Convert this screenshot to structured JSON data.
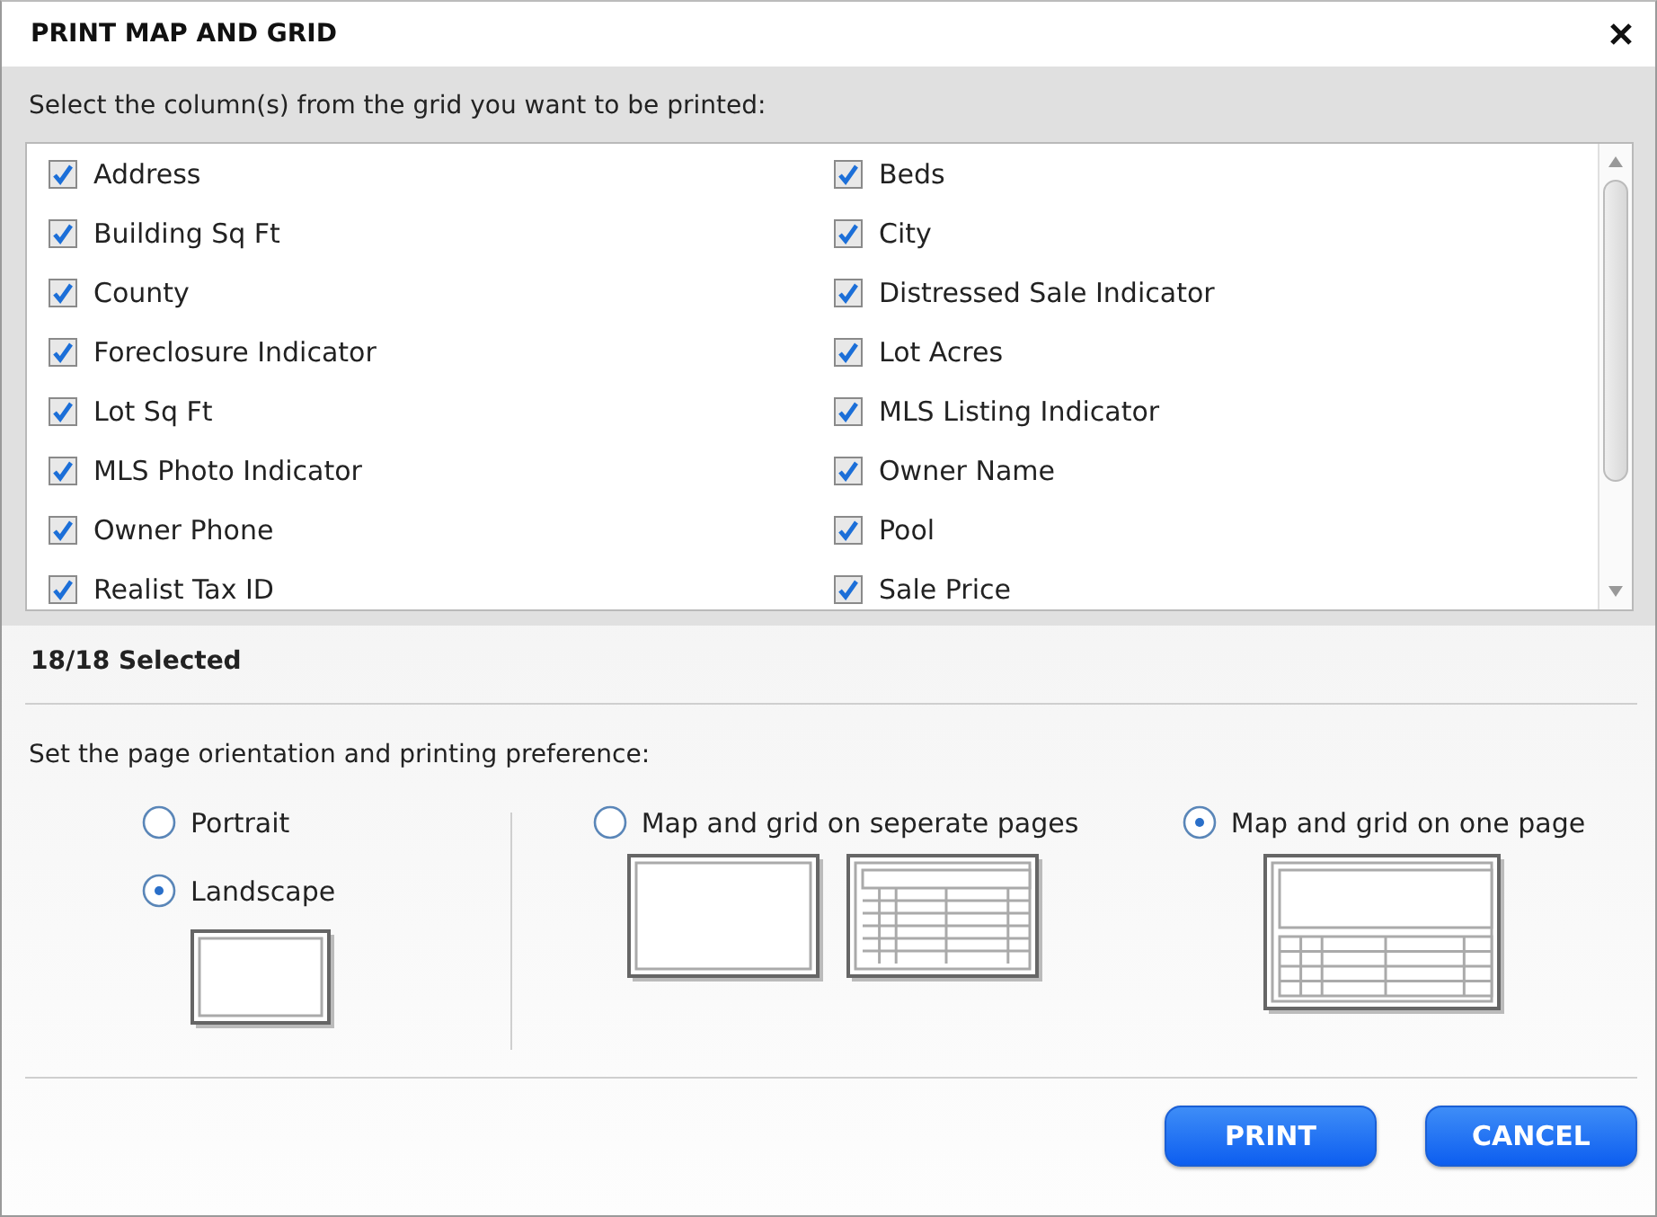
{
  "dialog": {
    "title": "PRINT MAP AND GRID"
  },
  "columns_prompt": "Select the column(s) from the grid you want to be printed:",
  "columns": [
    {
      "label": "Address",
      "checked": true
    },
    {
      "label": "Beds",
      "checked": true
    },
    {
      "label": "Building Sq Ft",
      "checked": true
    },
    {
      "label": "City",
      "checked": true
    },
    {
      "label": "County",
      "checked": true
    },
    {
      "label": "Distressed Sale Indicator",
      "checked": true
    },
    {
      "label": "Foreclosure Indicator",
      "checked": true
    },
    {
      "label": "Lot Acres",
      "checked": true
    },
    {
      "label": "Lot Sq Ft",
      "checked": true
    },
    {
      "label": "MLS Listing Indicator",
      "checked": true
    },
    {
      "label": "MLS Photo Indicator",
      "checked": true
    },
    {
      "label": "Owner Name",
      "checked": true
    },
    {
      "label": "Owner Phone",
      "checked": true
    },
    {
      "label": "Pool",
      "checked": true
    },
    {
      "label": "Realist Tax ID",
      "checked": true
    },
    {
      "label": "Sale Price",
      "checked": true
    }
  ],
  "selection_count": "18/18 Selected",
  "preference_prompt": "Set the page orientation and printing preference:",
  "orientations": [
    {
      "label": "Portrait",
      "selected": false
    },
    {
      "label": "Landscape",
      "selected": true
    }
  ],
  "layouts": [
    {
      "label": "Map and grid on seperate pages",
      "selected": false,
      "kind": "separate"
    },
    {
      "label": "Map and grid on one page",
      "selected": true,
      "kind": "combined"
    }
  ],
  "buttons": [
    {
      "label": "PRINT"
    },
    {
      "label": "CANCEL"
    }
  ]
}
